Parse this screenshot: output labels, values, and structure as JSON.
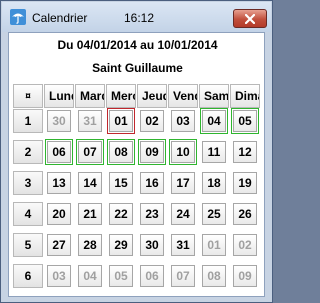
{
  "window": {
    "title": "Calendrier",
    "time": "16:12"
  },
  "header": {
    "date_range": "Du 04/01/2014 au 10/01/2014",
    "saint": "Saint Guillaume"
  },
  "calendar": {
    "corner_label": "¤",
    "day_headers": [
      "Lundi",
      "Mardi",
      "Mercredi",
      "Jeudi",
      "Vendredi",
      "Samedi",
      "Dimanche"
    ],
    "weeks": [
      {
        "number": "1",
        "days": [
          {
            "label": "30",
            "dim": true,
            "selected": false,
            "today": false
          },
          {
            "label": "31",
            "dim": true,
            "selected": false,
            "today": false
          },
          {
            "label": "01",
            "dim": false,
            "selected": false,
            "today": true
          },
          {
            "label": "02",
            "dim": false,
            "selected": false,
            "today": false
          },
          {
            "label": "03",
            "dim": false,
            "selected": false,
            "today": false
          },
          {
            "label": "04",
            "dim": false,
            "selected": true,
            "today": false
          },
          {
            "label": "05",
            "dim": false,
            "selected": true,
            "today": false
          }
        ]
      },
      {
        "number": "2",
        "days": [
          {
            "label": "06",
            "dim": false,
            "selected": true,
            "today": false
          },
          {
            "label": "07",
            "dim": false,
            "selected": true,
            "today": false
          },
          {
            "label": "08",
            "dim": false,
            "selected": true,
            "today": false
          },
          {
            "label": "09",
            "dim": false,
            "selected": true,
            "today": false
          },
          {
            "label": "10",
            "dim": false,
            "selected": true,
            "today": false
          },
          {
            "label": "11",
            "dim": false,
            "selected": false,
            "today": false
          },
          {
            "label": "12",
            "dim": false,
            "selected": false,
            "today": false
          }
        ]
      },
      {
        "number": "3",
        "days": [
          {
            "label": "13",
            "dim": false,
            "selected": false,
            "today": false
          },
          {
            "label": "14",
            "dim": false,
            "selected": false,
            "today": false
          },
          {
            "label": "15",
            "dim": false,
            "selected": false,
            "today": false
          },
          {
            "label": "16",
            "dim": false,
            "selected": false,
            "today": false
          },
          {
            "label": "17",
            "dim": false,
            "selected": false,
            "today": false
          },
          {
            "label": "18",
            "dim": false,
            "selected": false,
            "today": false
          },
          {
            "label": "19",
            "dim": false,
            "selected": false,
            "today": false
          }
        ]
      },
      {
        "number": "4",
        "days": [
          {
            "label": "20",
            "dim": false,
            "selected": false,
            "today": false
          },
          {
            "label": "21",
            "dim": false,
            "selected": false,
            "today": false
          },
          {
            "label": "22",
            "dim": false,
            "selected": false,
            "today": false
          },
          {
            "label": "23",
            "dim": false,
            "selected": false,
            "today": false
          },
          {
            "label": "24",
            "dim": false,
            "selected": false,
            "today": false
          },
          {
            "label": "25",
            "dim": false,
            "selected": false,
            "today": false
          },
          {
            "label": "26",
            "dim": false,
            "selected": false,
            "today": false
          }
        ]
      },
      {
        "number": "5",
        "days": [
          {
            "label": "27",
            "dim": false,
            "selected": false,
            "today": false
          },
          {
            "label": "28",
            "dim": false,
            "selected": false,
            "today": false
          },
          {
            "label": "29",
            "dim": false,
            "selected": false,
            "today": false
          },
          {
            "label": "30",
            "dim": false,
            "selected": false,
            "today": false
          },
          {
            "label": "31",
            "dim": false,
            "selected": false,
            "today": false
          },
          {
            "label": "01",
            "dim": true,
            "selected": false,
            "today": false
          },
          {
            "label": "02",
            "dim": true,
            "selected": false,
            "today": false
          }
        ]
      },
      {
        "number": "6",
        "days": [
          {
            "label": "03",
            "dim": true,
            "selected": false,
            "today": false
          },
          {
            "label": "04",
            "dim": true,
            "selected": false,
            "today": false
          },
          {
            "label": "05",
            "dim": true,
            "selected": false,
            "today": false
          },
          {
            "label": "06",
            "dim": true,
            "selected": false,
            "today": false
          },
          {
            "label": "07",
            "dim": true,
            "selected": false,
            "today": false
          },
          {
            "label": "08",
            "dim": true,
            "selected": false,
            "today": false
          },
          {
            "label": "09",
            "dim": true,
            "selected": false,
            "today": false
          }
        ]
      }
    ]
  },
  "colors": {
    "selection_ring": "#2fb52f",
    "today_ring": "#c0272d",
    "dim_text": "#a0a0a0"
  },
  "icons": {
    "app": "weather-umbrella-icon",
    "close": "close-icon"
  }
}
